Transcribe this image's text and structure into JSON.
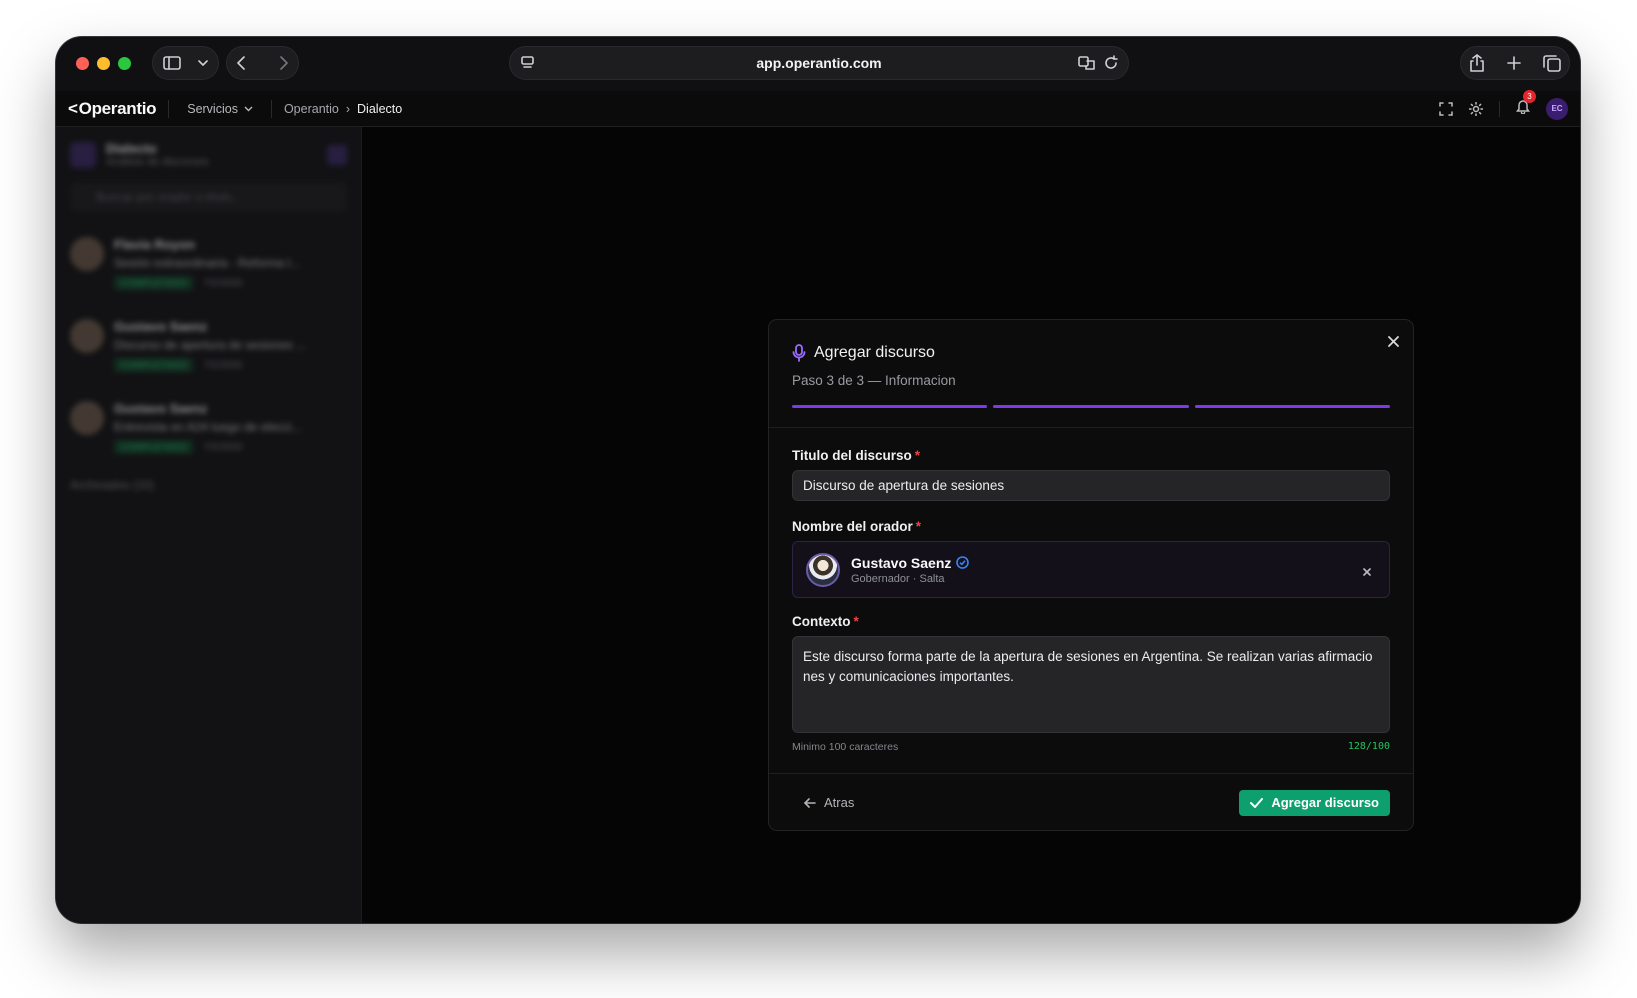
{
  "browser": {
    "url": "app.operantio.com"
  },
  "header": {
    "logo": "Operantio",
    "services_label": "Servicios",
    "breadcrumb": [
      "Operantio",
      "Dialecto"
    ],
    "notification_count": "3",
    "user_initials": "EC"
  },
  "sidebar": {
    "title": "Dialecto",
    "subtitle": "Análisis de discursos",
    "search_placeholder": "Buscar por orador o título...",
    "items": [
      {
        "name": "Flavia Royon",
        "desc": "Sesión extraordinaria - Reforma l...",
        "status": "COMPLETADO",
        "date": "7/2/2026"
      },
      {
        "name": "Gustavo Saenz",
        "desc": "Discurso de apertura de sesiones ...",
        "status": "COMPLETADO",
        "date": "7/2/2026"
      },
      {
        "name": "Gustavo Saenz",
        "desc": "Entrevista en A24 luego de elecci...",
        "status": "COMPLETADO",
        "date": "7/2/2026"
      }
    ],
    "archived": "Archivados (10)"
  },
  "modal": {
    "title": "Agregar discurso",
    "step_text": "Paso 3 de 3 — Informacion",
    "steps_total": 3,
    "steps_done": 3,
    "title_label": "Titulo del discurso",
    "title_value": "Discurso de apertura de sesiones",
    "speaker_label": "Nombre del orador",
    "speaker_name": "Gustavo Saenz",
    "speaker_role": "Gobernador · Salta",
    "context_label": "Contexto",
    "context_value": "Este discurso forma parte de la apertura de sesiones en Argentina. Se realizan varias afirmaciones y comunicaciones importantes.",
    "context_hint": "Minimo 100 caracteres",
    "context_counter": "128/100",
    "back_label": "Atras",
    "submit_label": "Agregar discurso"
  },
  "colors": {
    "accent": "#7c3aed",
    "success": "#0e9f6e",
    "required": "#ef4444",
    "verified": "#3b82f6"
  }
}
